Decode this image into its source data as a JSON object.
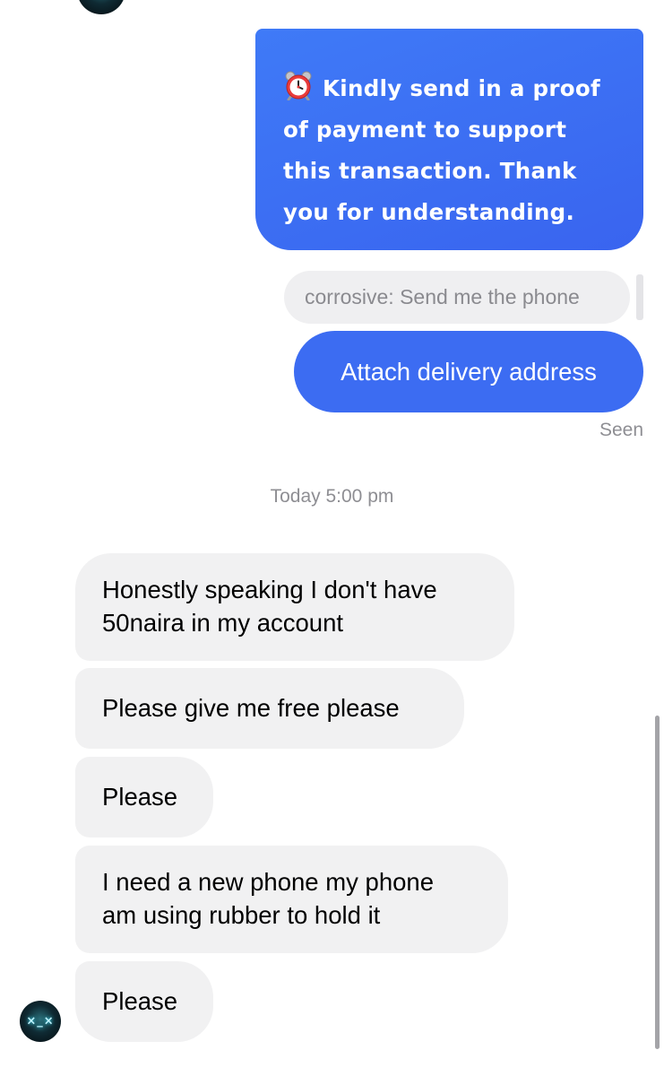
{
  "conversation": {
    "outgoing": {
      "proof_request": "Kindly send in a proof of payment to support this transaction. Thank you for understanding.",
      "proof_request_icon": "alarm-clock-icon",
      "reply_preview": "corrosive: Send me the phone",
      "delivery_address": "Attach delivery address",
      "status": "Seen",
      "bubble_color": "#3c6cf2"
    },
    "timestamp": "Today 5:00 pm",
    "incoming": {
      "messages": [
        {
          "line1": "Honestly speaking I don't have",
          "line2": "50naira in my account"
        },
        {
          "text": "Please give me free please"
        },
        {
          "text": "Please"
        },
        {
          "line1": "I need a new phone my phone",
          "line2": "am using rubber to hold it"
        },
        {
          "text": "Please"
        }
      ],
      "bubble_color": "#f1f1f2"
    }
  }
}
